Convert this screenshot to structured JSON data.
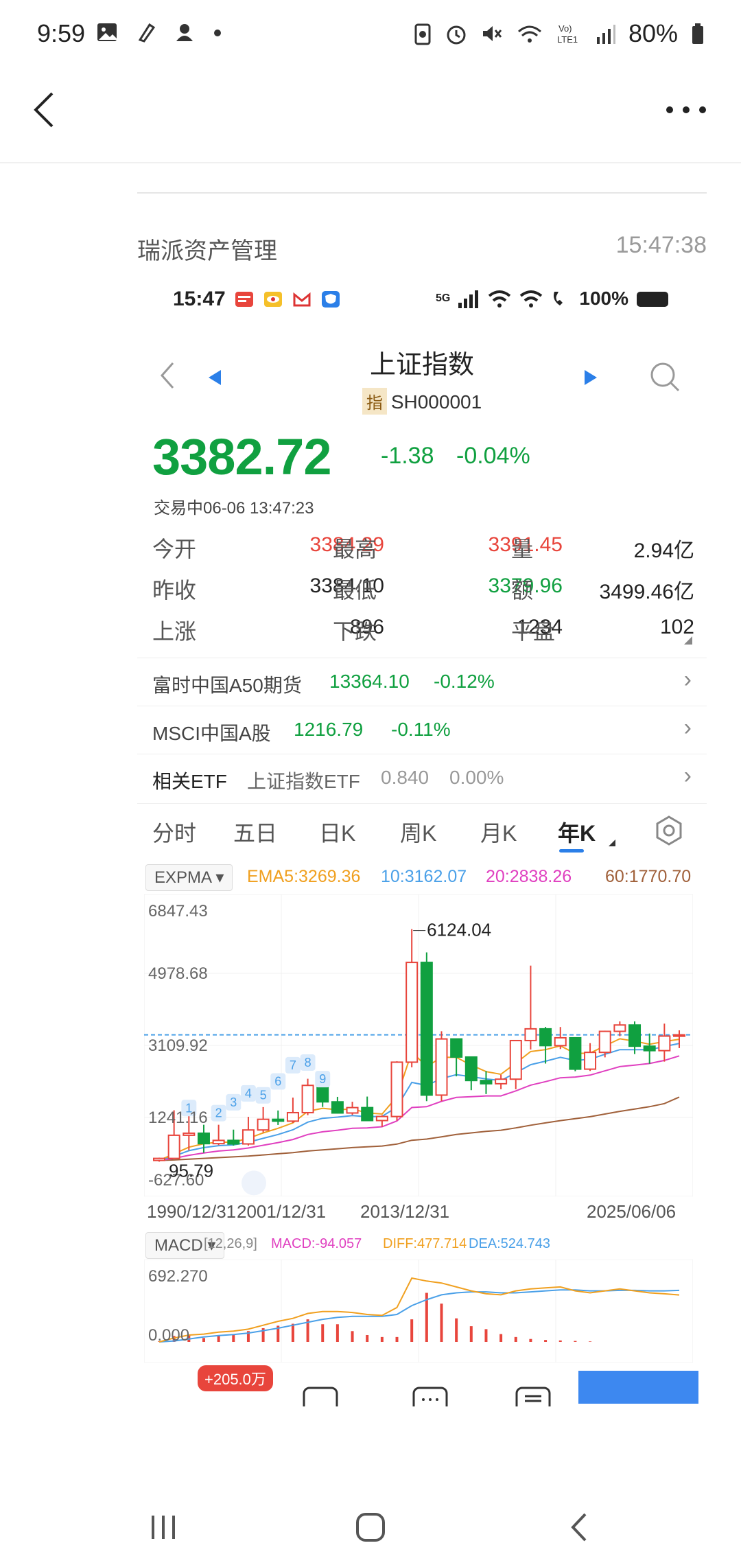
{
  "status": {
    "time": "9:59",
    "battery": "80%"
  },
  "message": {
    "sender": "瑞派资产管理",
    "time": "15:47:38"
  },
  "shot_status": {
    "time": "15:47",
    "network": "5G",
    "battery": "100%"
  },
  "stock": {
    "name": "上证指数",
    "code_badge": "指",
    "code": "SH000001",
    "price": "3382.72",
    "change": "-1.38",
    "change_pct": "-0.04%",
    "trade_status": "交易中06-06 13:47:23"
  },
  "quotes": [
    {
      "label": "今开",
      "value": "3384.29",
      "color": "red"
    },
    {
      "label": "最高",
      "value": "3391.45",
      "color": "red"
    },
    {
      "label": "量",
      "value": "2.94亿",
      "color": "dark"
    },
    {
      "label": "昨收",
      "value": "3384.10",
      "color": "dark"
    },
    {
      "label": "最低",
      "value": "3379.96",
      "color": "green"
    },
    {
      "label": "额",
      "value": "3499.46亿",
      "color": "dark"
    },
    {
      "label": "上涨",
      "value": "896",
      "color": "dark"
    },
    {
      "label": "下跌",
      "value": "1234",
      "color": "dark"
    },
    {
      "label": "平盘",
      "value": "102",
      "color": "dark"
    }
  ],
  "links": [
    {
      "name": "富时中国A50期货",
      "value": "13364.10",
      "pct": "-0.12%"
    },
    {
      "name": "MSCI中国A股",
      "value": "1216.79",
      "pct": "-0.11%"
    },
    {
      "name": "相关ETF",
      "sub": "上证指数ETF",
      "value": "0.840",
      "pct": "0.00%"
    }
  ],
  "tabs": [
    "分时",
    "五日",
    "日K",
    "周K",
    "月K",
    "年K"
  ],
  "ema": {
    "chip": "EXPMA",
    "ema5": "EMA5:3269.36",
    "ema10": "10:3162.07",
    "ema20": "20:2838.26",
    "ema60": "60:1770.70"
  },
  "chart_data": {
    "type": "candlestick",
    "y_ticks": [
      "6847.43",
      "4978.68",
      "3109.92",
      "1241.16",
      "-627.60"
    ],
    "ylim": [
      -627.6,
      6847.43
    ],
    "high_label": "6124.04",
    "low_label": "95.79",
    "x_labels": [
      "1990/12/31",
      "2001/12/31",
      "2013/12/31",
      "2025/06/06"
    ],
    "current_price": 3382.72,
    "candles": [
      {
        "o": 127,
        "c": 180,
        "h": 200,
        "l": 95
      },
      {
        "o": 180,
        "c": 780,
        "h": 1429,
        "l": 180
      },
      {
        "o": 780,
        "c": 833,
        "h": 1558,
        "l": 386
      },
      {
        "o": 833,
        "c": 562,
        "h": 1052,
        "l": 325
      },
      {
        "o": 562,
        "c": 647,
        "h": 1052,
        "l": 524
      },
      {
        "o": 647,
        "c": 555,
        "h": 926,
        "l": 512
      },
      {
        "o": 555,
        "c": 917,
        "h": 1258,
        "l": 512
      },
      {
        "o": 917,
        "c": 1194,
        "h": 1510,
        "l": 855
      },
      {
        "o": 1194,
        "c": 1146,
        "h": 1422,
        "l": 1047
      },
      {
        "o": 1146,
        "c": 1366,
        "h": 1756,
        "l": 1100
      },
      {
        "o": 1366,
        "c": 2073,
        "h": 2245,
        "l": 1300
      },
      {
        "o": 2073,
        "c": 1646,
        "h": 2131,
        "l": 1514
      },
      {
        "o": 1646,
        "c": 1357,
        "h": 1776,
        "l": 1340
      },
      {
        "o": 1357,
        "c": 1497,
        "h": 1649,
        "l": 1307
      },
      {
        "o": 1497,
        "c": 1161,
        "h": 1783,
        "l": 1259
      },
      {
        "o": 1161,
        "c": 1266,
        "h": 1300,
        "l": 998
      },
      {
        "o": 1266,
        "c": 2675,
        "h": 2698,
        "l": 1161
      },
      {
        "o": 2675,
        "c": 5262,
        "h": 6124,
        "l": 2541
      },
      {
        "o": 5262,
        "c": 1821,
        "h": 5522,
        "l": 1664
      },
      {
        "o": 1821,
        "c": 3277,
        "h": 3478,
        "l": 1664
      },
      {
        "o": 3277,
        "c": 2808,
        "h": 3186,
        "l": 2307
      },
      {
        "o": 2808,
        "c": 2199,
        "h": 2478,
        "l": 1949
      },
      {
        "o": 2199,
        "c": 2116,
        "h": 2444,
        "l": 1849
      },
      {
        "o": 2116,
        "c": 2234,
        "h": 2349,
        "l": 1974
      },
      {
        "o": 2234,
        "c": 3235,
        "h": 3239,
        "l": 1974
      },
      {
        "o": 3235,
        "c": 3539,
        "h": 5178,
        "l": 3004
      },
      {
        "o": 3539,
        "c": 3104,
        "h": 3588,
        "l": 2638
      },
      {
        "o": 3104,
        "c": 3307,
        "h": 3587,
        "l": 3016
      },
      {
        "o": 3307,
        "c": 2494,
        "h": 3288,
        "l": 2440
      },
      {
        "o": 2494,
        "c": 2929,
        "h": 3168,
        "l": 2447
      },
      {
        "o": 2929,
        "c": 3474,
        "h": 3492,
        "l": 2800
      },
      {
        "o": 3474,
        "c": 3639,
        "h": 3731,
        "l": 3349
      },
      {
        "o": 3639,
        "c": 3089,
        "h": 3731,
        "l": 2885
      },
      {
        "o": 3089,
        "c": 2974,
        "h": 3418,
        "l": 2635
      },
      {
        "o": 2974,
        "c": 3351,
        "h": 3674,
        "l": 2689
      },
      {
        "o": 3351,
        "c": 3383,
        "h": 3500,
        "l": 3040
      }
    ],
    "ema5": [
      127,
      300,
      470,
      560,
      600,
      600,
      700,
      840,
      960,
      1100,
      1400,
      1480,
      1440,
      1460,
      1360,
      1330,
      1780,
      2940,
      2560,
      2800,
      2800,
      2600,
      2430,
      2360,
      2650,
      2950,
      3000,
      3100,
      2900,
      2910,
      3100,
      3280,
      3220,
      3140,
      3210,
      3269
    ],
    "ema10": [
      127,
      240,
      380,
      460,
      510,
      530,
      600,
      700,
      800,
      920,
      1120,
      1220,
      1250,
      1290,
      1260,
      1270,
      1510,
      2150,
      2070,
      2250,
      2350,
      2300,
      2240,
      2200,
      2400,
      2610,
      2700,
      2800,
      2720,
      2750,
      2880,
      3000,
      3000,
      3000,
      3080,
      3162
    ],
    "ema20": [
      127,
      180,
      260,
      320,
      370,
      400,
      450,
      520,
      590,
      670,
      800,
      870,
      910,
      960,
      970,
      1000,
      1150,
      1500,
      1520,
      1660,
      1760,
      1780,
      1800,
      1800,
      1930,
      2080,
      2170,
      2270,
      2290,
      2340,
      2450,
      2560,
      2600,
      2640,
      2720,
      2838
    ],
    "ema60": [
      127,
      140,
      160,
      180,
      200,
      220,
      240,
      270,
      300,
      330,
      370,
      400,
      430,
      460,
      480,
      500,
      550,
      650,
      680,
      740,
      800,
      840,
      880,
      910,
      970,
      1040,
      1100,
      1160,
      1210,
      1260,
      1330,
      1400,
      1460,
      1520,
      1600,
      1770
    ]
  },
  "candle_numbers": [
    "1",
    "2",
    "3",
    "4",
    "5",
    "6",
    "7",
    "8",
    "9"
  ],
  "macd": {
    "chip": "MACD",
    "params": "[12,26,9]",
    "macd": "MACD:-94.057",
    "diff": "DIFF:477.714",
    "dea": "DEA:524.743",
    "y_ticks": [
      "692.270",
      "0.000"
    ],
    "hist": [
      5,
      60,
      75,
      40,
      60,
      70,
      110,
      140,
      165,
      185,
      230,
      180,
      180,
      110,
      70,
      50,
      50,
      230,
      500,
      390,
      240,
      160,
      130,
      80,
      50,
      30,
      20,
      15,
      10,
      5,
      0,
      0,
      0,
      0,
      0,
      0
    ],
    "diff_line": [
      0,
      40,
      70,
      80,
      100,
      110,
      130,
      170,
      210,
      240,
      290,
      310,
      310,
      300,
      280,
      270,
      350,
      650,
      620,
      600,
      560,
      520,
      490,
      480,
      520,
      540,
      550,
      560,
      520,
      500,
      520,
      540,
      520,
      500,
      490,
      478
    ],
    "dea_line": [
      0,
      10,
      30,
      50,
      65,
      75,
      90,
      115,
      140,
      170,
      200,
      230,
      250,
      260,
      260,
      260,
      280,
      370,
      430,
      480,
      500,
      510,
      510,
      500,
      500,
      510,
      520,
      530,
      530,
      520,
      520,
      525,
      525,
      520,
      520,
      525
    ]
  },
  "toolbar": {
    "badge": "+205.0万"
  },
  "colors": {
    "up": "#e8453c",
    "down": "#10a040",
    "ema5": "#f0a020",
    "ema10": "#4aa0e8",
    "ema20": "#e040c0",
    "ema60": "#a0603a"
  }
}
